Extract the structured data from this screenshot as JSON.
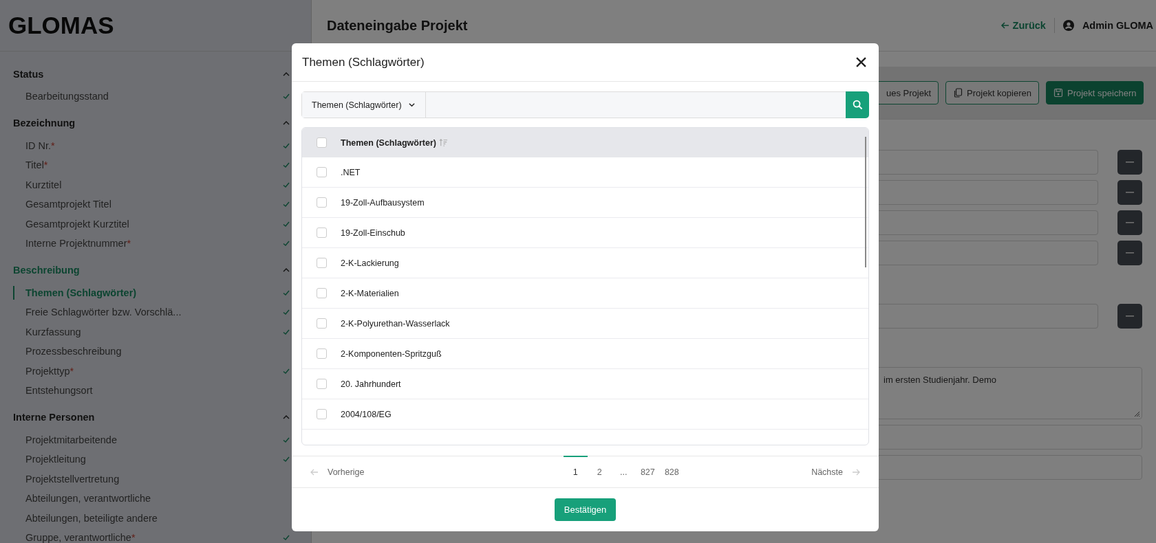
{
  "app": {
    "logo": "GLOMAS"
  },
  "sidebar": {
    "required_mark": "*",
    "sections": [
      {
        "title": "Status",
        "expanded": true,
        "active": false,
        "items": [
          {
            "label": "Bearbeitungsstand",
            "required": false,
            "done": true,
            "selected": false
          }
        ]
      },
      {
        "title": "Bezeichnung",
        "expanded": true,
        "active": false,
        "items": [
          {
            "label": "ID Nr.",
            "required": true,
            "done": true,
            "selected": false
          },
          {
            "label": "Titel",
            "required": true,
            "done": true,
            "selected": false
          },
          {
            "label": "Kurztitel",
            "required": false,
            "done": true,
            "selected": false
          },
          {
            "label": "Gesamtprojekt Titel",
            "required": false,
            "done": true,
            "selected": false
          },
          {
            "label": "Gesamtprojekt Kurztitel",
            "required": false,
            "done": true,
            "selected": false
          },
          {
            "label": "Interne Projektnummer",
            "required": true,
            "done": true,
            "selected": false
          }
        ]
      },
      {
        "title": "Beschreibung",
        "expanded": true,
        "active": true,
        "items": [
          {
            "label": "Themen (Schlagwörter)",
            "required": false,
            "done": true,
            "selected": true
          },
          {
            "label": "Freie Schlagwörter bzw. Vorschlä...",
            "required": false,
            "done": true,
            "selected": false
          },
          {
            "label": "Kurzfassung",
            "required": false,
            "done": true,
            "selected": false
          },
          {
            "label": "Prozessbeschreibung",
            "required": false,
            "done": false,
            "selected": false
          },
          {
            "label": "Projekttyp",
            "required": true,
            "done": true,
            "selected": false
          },
          {
            "label": "Entstehungsort",
            "required": false,
            "done": false,
            "selected": false
          }
        ]
      },
      {
        "title": "Interne Personen",
        "expanded": true,
        "active": false,
        "items": [
          {
            "label": "Projektmitarbeitende",
            "required": false,
            "done": true,
            "selected": false
          },
          {
            "label": "Projektleitung",
            "required": false,
            "done": true,
            "selected": false
          },
          {
            "label": "Projektstellvertretung",
            "required": false,
            "done": false,
            "selected": false
          },
          {
            "label": "Abteilungen, verantwortliche",
            "required": false,
            "done": false,
            "selected": false
          },
          {
            "label": "Abteilungen, beteiligte andere",
            "required": false,
            "done": false,
            "selected": false
          },
          {
            "label": "Gruppe, verantwortliche",
            "required": true,
            "done": true,
            "selected": false
          }
        ]
      }
    ]
  },
  "header": {
    "title": "Dateneingabe Projekt",
    "back_link": "Zurück",
    "user": "Admin GLOMA"
  },
  "toolbar": {
    "buttons": [
      {
        "label": "ues Projekt",
        "kind": "new"
      },
      {
        "label": "Projekt kopieren",
        "kind": "copy"
      },
      {
        "label": "Projekt speichern",
        "kind": "save"
      }
    ]
  },
  "form": {
    "fields": [
      {
        "kind": "input",
        "removable": true
      },
      {
        "kind": "input",
        "removable": true
      },
      {
        "kind": "input",
        "removable": true
      },
      {
        "kind": "input",
        "removable": true
      },
      {
        "kind": "gap"
      },
      {
        "kind": "input",
        "removable": true
      },
      {
        "kind": "gap"
      },
      {
        "kind": "textarea",
        "value": "im ersten Studienjahr. Demo"
      },
      {
        "kind": "input",
        "removable": false
      },
      {
        "kind": "input",
        "removable": false
      }
    ]
  },
  "modal": {
    "title": "Themen (Schlagwörter)",
    "search": {
      "scope": "Themen (Schlagwörter)"
    },
    "table": {
      "column": "Themen (Schlagwörter)",
      "all_checked": false,
      "rows": [
        {
          "label": ".NET",
          "checked": false
        },
        {
          "label": "19-Zoll-Aufbausystem",
          "checked": false
        },
        {
          "label": "19-Zoll-Einschub",
          "checked": false
        },
        {
          "label": "2-K-Lackierung",
          "checked": false
        },
        {
          "label": "2-K-Materialien",
          "checked": false
        },
        {
          "label": "2-K-Polyurethan-Wasserlack",
          "checked": false
        },
        {
          "label": "2-Komponenten-Spritzguß",
          "checked": false
        },
        {
          "label": "20. Jahrhundert",
          "checked": false
        },
        {
          "label": "2004/108/EG",
          "checked": false
        }
      ]
    },
    "pagination": {
      "previous": "Vorherige",
      "next": "Nächste",
      "pages": [
        {
          "label": "1",
          "selected": true
        },
        {
          "label": "2",
          "selected": false
        },
        {
          "label": "...",
          "selected": false
        },
        {
          "label": "827",
          "selected": false
        },
        {
          "label": "828",
          "selected": false
        }
      ]
    },
    "confirm_button": "Bestätigen"
  }
}
